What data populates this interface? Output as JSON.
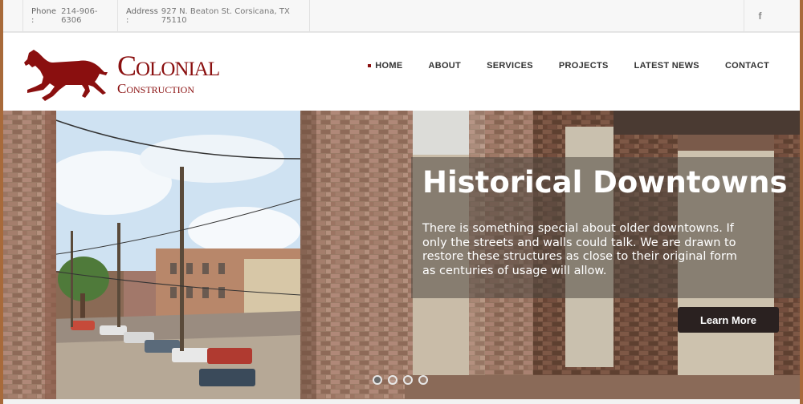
{
  "topbar": {
    "phone_label": "Phone :",
    "phone_value": "214-906-6306",
    "address_label": "Address :",
    "address_value": "927 N. Beaton St. Corsicana, TX 75110",
    "social_icon": "facebook-icon",
    "social_glyph": "f"
  },
  "logo": {
    "line1": "Colonial",
    "line2": "Construction",
    "mark": "horse-icon",
    "color": "#8a0f0f"
  },
  "nav": {
    "items": [
      {
        "label": "HOME",
        "active": true
      },
      {
        "label": "ABOUT"
      },
      {
        "label": "SERVICES"
      },
      {
        "label": "PROJECTS"
      },
      {
        "label": "LATEST NEWS"
      },
      {
        "label": "CONTACT"
      }
    ]
  },
  "hero": {
    "title": "Historical Downtowns",
    "text": "There is something special about older downtowns. If only the streets and walls could talk. We are drawn to restore these structures as close to their original form as centuries of usage will allow.",
    "button_label": "Learn More",
    "slide_count": 4,
    "active_slide": 1
  }
}
